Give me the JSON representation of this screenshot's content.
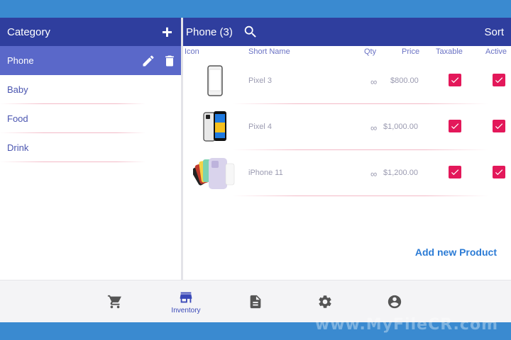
{
  "category_panel": {
    "title": "Category",
    "items": [
      {
        "label": "Phone",
        "selected": true
      },
      {
        "label": "Baby"
      },
      {
        "label": "Food"
      },
      {
        "label": "Drink"
      }
    ]
  },
  "product_panel": {
    "title": "Phone (3)",
    "sort_label": "Sort",
    "columns": {
      "icon": "Icon",
      "short_name": "Short Name",
      "qty": "Qty",
      "price": "Price",
      "taxable": "Taxable",
      "active": "Active"
    },
    "products": [
      {
        "name": "Pixel 3",
        "qty": "∞",
        "price": "$800.00",
        "taxable": true,
        "active": true
      },
      {
        "name": "Pixel 4",
        "qty": "∞",
        "price": "$1,000.00",
        "taxable": true,
        "active": true
      },
      {
        "name": "iPhone 11",
        "qty": "∞",
        "price": "$1,200.00",
        "taxable": true,
        "active": true
      }
    ],
    "add_label": "Add new Product"
  },
  "bottom_nav": {
    "items": [
      {
        "icon": "cart-icon"
      },
      {
        "icon": "store-icon",
        "label": "Inventory",
        "active": true
      },
      {
        "icon": "document-icon"
      },
      {
        "icon": "gear-icon"
      },
      {
        "icon": "account-icon"
      }
    ]
  },
  "watermark": "www.MyFileCR.com",
  "colors": {
    "header": "#2f3e9e",
    "selected": "#5a68c9",
    "checkbox": "#e3185a",
    "link": "#2b7bd5",
    "frame": "#3a8ad0"
  }
}
